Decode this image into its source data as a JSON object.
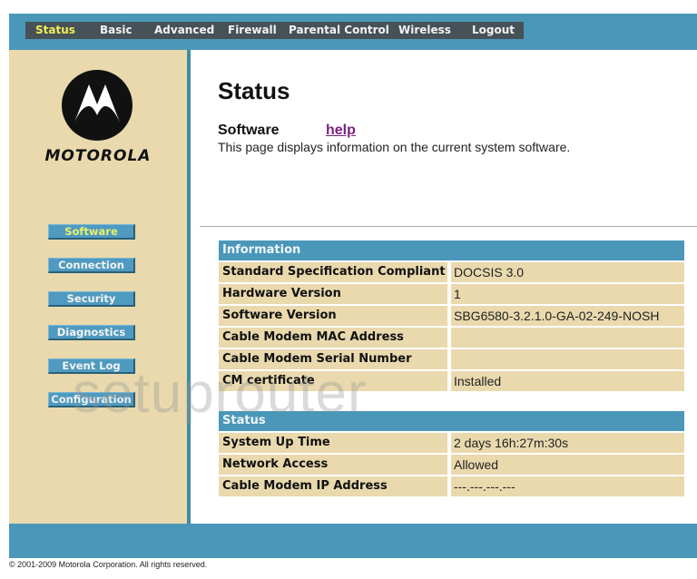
{
  "nav": {
    "items": [
      {
        "label": "Status",
        "active": true
      },
      {
        "label": "Basic"
      },
      {
        "label": "Advanced"
      },
      {
        "label": "Firewall"
      },
      {
        "label": "Parental Control"
      },
      {
        "label": "Wireless"
      },
      {
        "label": "Logout"
      }
    ]
  },
  "brand": {
    "name": "MOTOROLA",
    "logo_icon": "motorola-batwing-icon"
  },
  "sidebar": {
    "items": [
      {
        "label": "Software",
        "active": true
      },
      {
        "label": "Connection"
      },
      {
        "label": "Security"
      },
      {
        "label": "Diagnostics"
      },
      {
        "label": "Event Log"
      },
      {
        "label": "Configuration"
      }
    ]
  },
  "main": {
    "title": "Status",
    "section": "Software",
    "help_label": "help",
    "description": "This page displays information on the current system software."
  },
  "info_table": {
    "header": "Information",
    "rows": [
      {
        "key": "Standard Specification Compliant",
        "value": "DOCSIS 3.0"
      },
      {
        "key": "Hardware Version",
        "value": "1"
      },
      {
        "key": "Software Version",
        "value": "SBG6580-3.2.1.0-GA-02-249-NOSH"
      },
      {
        "key": "Cable Modem MAC Address",
        "value": ""
      },
      {
        "key": "Cable Modem Serial Number",
        "value": ""
      },
      {
        "key": "CM certificate",
        "value": "Installed"
      }
    ]
  },
  "status_table": {
    "header": "Status",
    "rows": [
      {
        "key": "System Up Time",
        "value": "2 days 16h:27m:30s"
      },
      {
        "key": "Network Access",
        "value": "Allowed"
      },
      {
        "key": "Cable Modem IP Address",
        "value": "---.---.---.---"
      }
    ]
  },
  "footer": {
    "copyright": "© 2001-2009 Motorola Corporation. All rights reserved."
  },
  "watermark": "setuprouter",
  "colors": {
    "bar_blue": "#4a97b9",
    "nav_dark": "#465158",
    "tan": "#e9d9ad",
    "active_yellow": "#f0ee58",
    "help_purple": "#7b1f7e"
  }
}
